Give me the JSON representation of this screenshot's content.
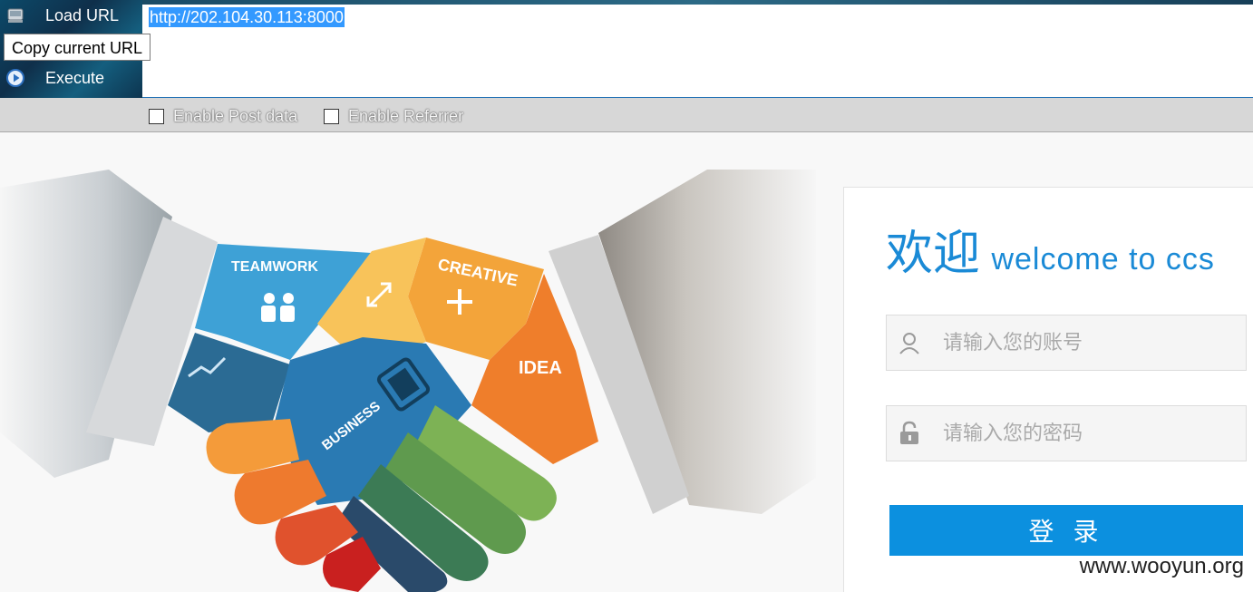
{
  "toolbar": {
    "load_url_label": "Load URL",
    "execute_label": "Execute",
    "tooltip": "Copy current URL",
    "url_value": "http://202.104.30.113:8000",
    "enable_post_label": "Enable Post data",
    "enable_referrer_label": "Enable Referrer"
  },
  "illustration": {
    "teamwork": "TEAMWORK",
    "creative": "CREATIVE",
    "idea": "IDEA",
    "business": "BUSINESS"
  },
  "login": {
    "welcome_cn": "欢迎",
    "welcome_en": "welcome to ccs",
    "username_placeholder": "请输入您的账号",
    "password_placeholder": "请输入您的密码",
    "submit_label": "登 录"
  },
  "watermark": "www.wooyun.org",
  "colors": {
    "accent": "#0c90df",
    "welcome_text": "#1a8ad6"
  }
}
